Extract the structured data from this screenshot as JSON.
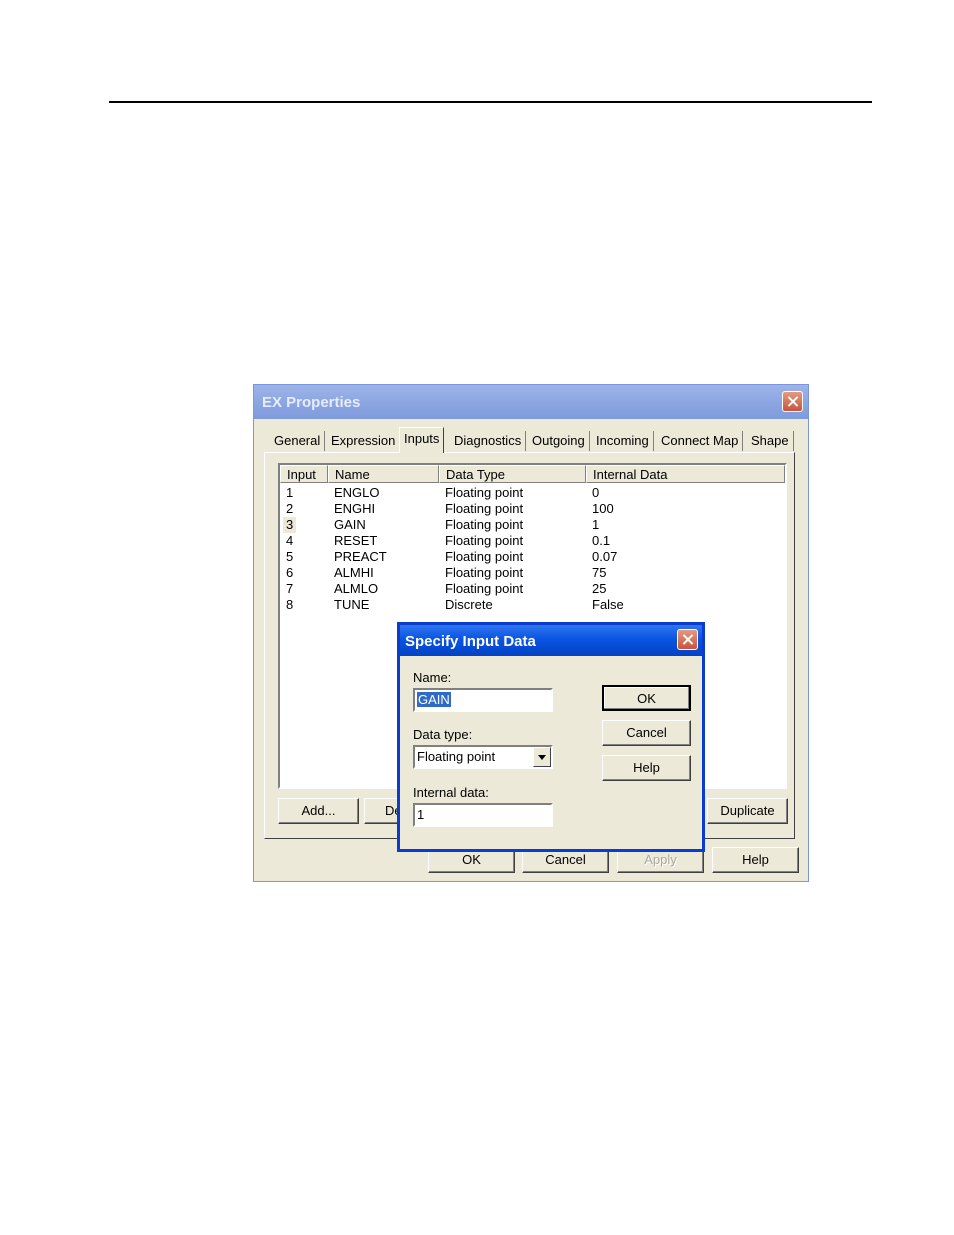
{
  "main_dialog": {
    "title": "EX Properties",
    "tabs": [
      "General",
      "Expression",
      "Inputs",
      "Diagnostics",
      "Outgoing",
      "Incoming",
      "Connect Map",
      "Shape"
    ],
    "active_tab": "Inputs",
    "columns": [
      "Input",
      "Name",
      "Data Type",
      "Internal Data"
    ],
    "rows": [
      {
        "input": "1",
        "name": "ENGLO",
        "type": "Floating point",
        "data": "0"
      },
      {
        "input": "2",
        "name": "ENGHI",
        "type": "Floating point",
        "data": "100"
      },
      {
        "input": "3",
        "name": "GAIN",
        "type": "Floating point",
        "data": "1"
      },
      {
        "input": "4",
        "name": "RESET",
        "type": "Floating point",
        "data": "0.1"
      },
      {
        "input": "5",
        "name": "PREACT",
        "type": "Floating point",
        "data": "0.07"
      },
      {
        "input": "6",
        "name": "ALMHI",
        "type": "Floating point",
        "data": "75"
      },
      {
        "input": "7",
        "name": "ALMLO",
        "type": "Floating point",
        "data": "25"
      },
      {
        "input": "8",
        "name": "TUNE",
        "type": "Discrete",
        "data": "False"
      }
    ],
    "list_buttons": {
      "add": "Add...",
      "delete_partial": "De",
      "duplicate": "Duplicate"
    },
    "footer_buttons": {
      "ok": "OK",
      "cancel": "Cancel",
      "apply": "Apply",
      "help": "Help"
    }
  },
  "sub_dialog": {
    "title": "Specify Input Data",
    "name_label": "Name:",
    "name_value": "GAIN",
    "data_type_label": "Data type:",
    "data_type_value": "Floating point",
    "internal_label": "Internal data:",
    "internal_value": "1",
    "buttons": {
      "ok": "OK",
      "cancel": "Cancel",
      "help": "Help"
    }
  }
}
